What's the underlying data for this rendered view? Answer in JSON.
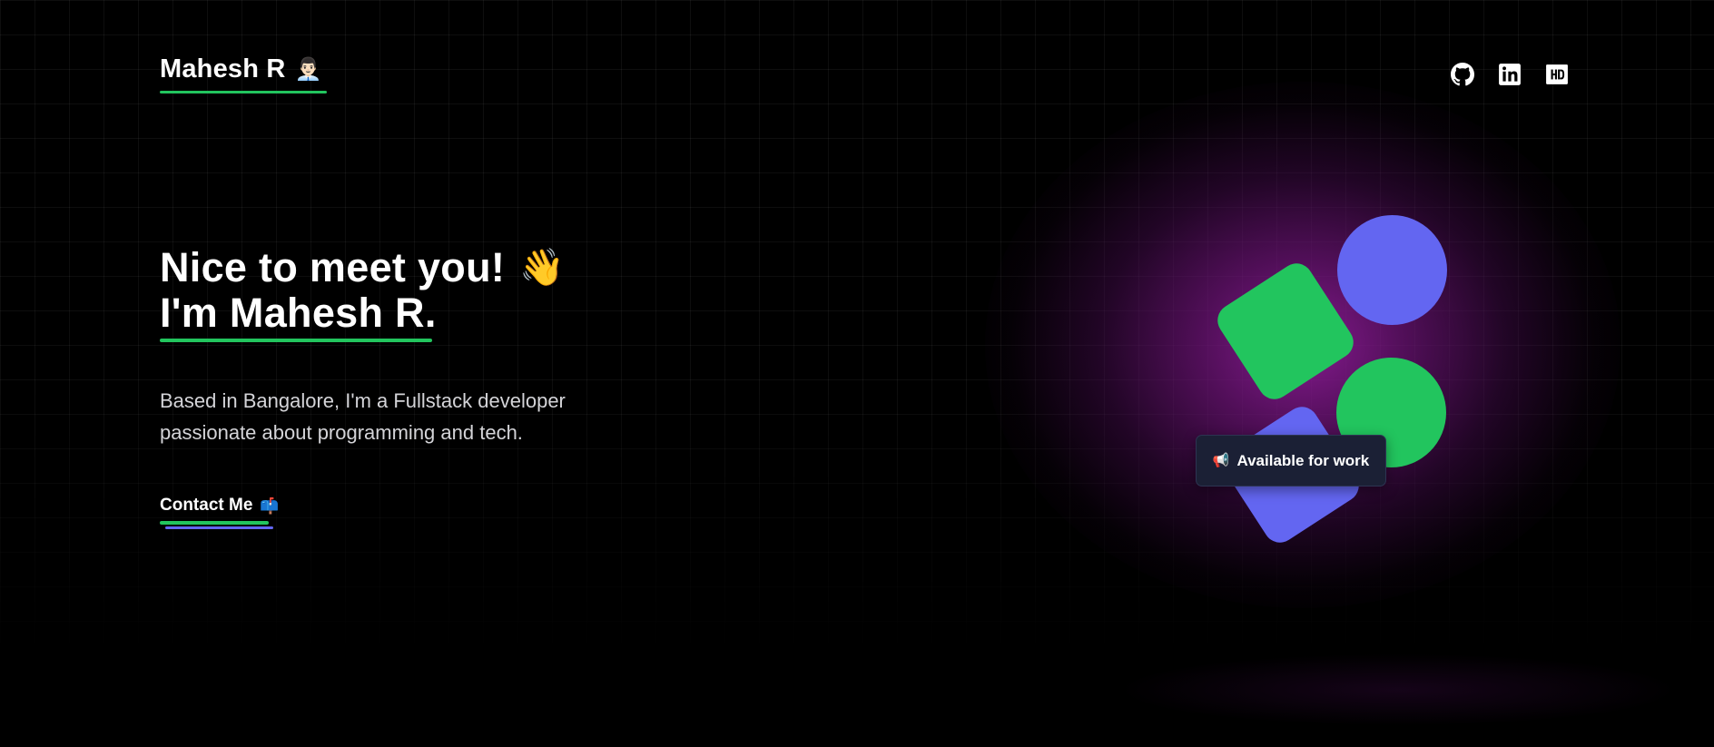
{
  "header": {
    "brand_name": "Mahesh R",
    "brand_emoji": "👨🏻‍💼",
    "social_icons": [
      "github-icon",
      "linkedin-icon",
      "hashnode-icon"
    ]
  },
  "hero": {
    "title_line1": "Nice to meet you!",
    "title_emoji": "👋",
    "title_line2": "I'm Mahesh R.",
    "description_line1": "Based in Bangalore, I'm a Fullstack developer",
    "description_line2": "passionate about programming and tech.",
    "contact_label": "Contact Me",
    "contact_emoji": "📫"
  },
  "status_badge": {
    "emoji": "📢",
    "label": "Available for work"
  },
  "colors": {
    "background": "#000000",
    "accent_green": "#22c55e",
    "accent_indigo": "#6366f1",
    "glow_purple": "#8c1c96",
    "badge_bg": "#1b2035"
  }
}
